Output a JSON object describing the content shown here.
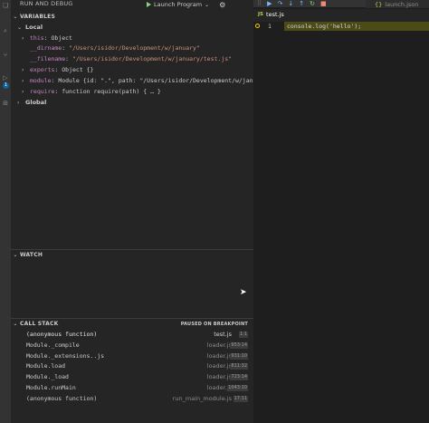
{
  "header": {
    "run_debug_title": "RUN AND DEBUG",
    "launch_config": "Launch Program"
  },
  "activity_badge": "1",
  "variables": {
    "title": "VARIABLES",
    "local_label": "Local",
    "global_label": "Global",
    "items": [
      {
        "name": "this",
        "value": "Object"
      },
      {
        "name": "__dirname",
        "value": "\"/Users/isidor/Development/w/january\""
      },
      {
        "name": "__filename",
        "value": "\"/Users/isidor/Development/w/january/test.js\""
      },
      {
        "name": "exports",
        "value": "Object {}"
      },
      {
        "name": "module",
        "value": "Module {id: \".\", path: \"/Users/isidor/Development/w/january\""
      },
      {
        "name": "require",
        "value": "function require(path) { … }"
      }
    ]
  },
  "watch": {
    "title": "WATCH"
  },
  "call_stack": {
    "title": "CALL STACK",
    "status": "PAUSED ON BREAKPOINT",
    "frames": [
      {
        "fn": "(anonymous function)",
        "file": "test.js",
        "line": "1:1"
      },
      {
        "fn": "Module._compile",
        "file": "loader.js",
        "line": "953:14"
      },
      {
        "fn": "Module._extensions..js",
        "file": "loader.js",
        "line": "931:10"
      },
      {
        "fn": "Module.load",
        "file": "loader.js",
        "line": "811:32"
      },
      {
        "fn": "Module._load",
        "file": "loader.js",
        "line": "723:14"
      },
      {
        "fn": "Module.runMain",
        "file": "loader.js",
        "line": "1043:10"
      },
      {
        "fn": "(anonymous function)",
        "file": "run_main_module.js",
        "line": "17:11"
      }
    ]
  },
  "editor": {
    "active_tab": "test.js",
    "active_tab_badge": "JS",
    "second_tab": "launch.json",
    "second_tab_icon": "{}",
    "line_number": "1",
    "code": "console.log('hello');"
  },
  "colors": {
    "accent": "#0e639c",
    "breakpoint_line": "#4b4b18",
    "play_green": "#89d185",
    "string": "#ce9178",
    "variable_name": "#c586c0"
  }
}
